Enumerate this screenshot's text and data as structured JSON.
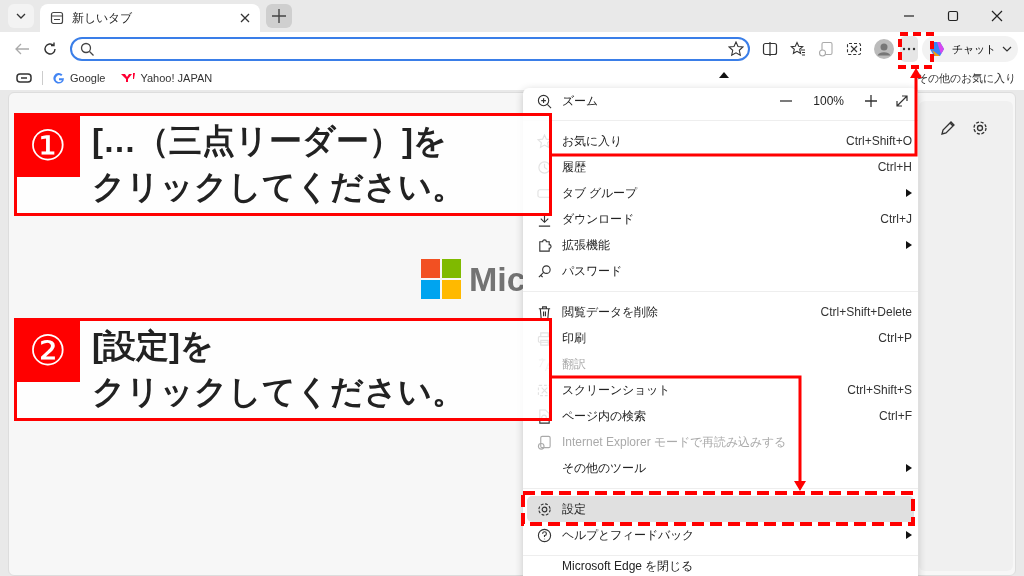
{
  "tabs": [
    {
      "title": "新しいタブ",
      "selected": true
    }
  ],
  "toolbar": {
    "chat_label": "チャット"
  },
  "bookmarks": [
    {
      "label": "Google"
    },
    {
      "label": "Yahoo! JAPAN"
    }
  ],
  "other_favorites": "その他のお気に入り",
  "logo_text": "Mic",
  "menu": {
    "zoom": {
      "label": "ズーム",
      "value": "100%"
    },
    "groups": [
      [
        {
          "label": "お気に入り",
          "shortcut": "Ctrl+Shift+O",
          "submenu": false,
          "disabled": false,
          "selected": false
        },
        {
          "label": "履歴",
          "shortcut": "Ctrl+H",
          "submenu": false,
          "disabled": false,
          "selected": false
        },
        {
          "label": "タブ グループ",
          "submenu": true,
          "disabled": false,
          "selected": false
        },
        {
          "label": "ダウンロード",
          "shortcut": "Ctrl+J",
          "submenu": false,
          "disabled": false,
          "selected": false
        },
        {
          "label": "拡張機能",
          "submenu": true,
          "disabled": false,
          "selected": false
        },
        {
          "label": "パスワード",
          "submenu": false,
          "disabled": false,
          "selected": false
        }
      ],
      [
        {
          "label": "閲覧データを削除",
          "shortcut": "Ctrl+Shift+Delete",
          "submenu": false,
          "disabled": false,
          "selected": false
        },
        {
          "label": "印刷",
          "shortcut": "Ctrl+P",
          "submenu": false,
          "disabled": false,
          "selected": false
        },
        {
          "label": "翻訳",
          "submenu": false,
          "disabled": true,
          "selected": false
        },
        {
          "label": "スクリーンショット",
          "shortcut": "Ctrl+Shift+S",
          "submenu": false,
          "disabled": false,
          "selected": false
        },
        {
          "label": "ページ内の検索",
          "shortcut": "Ctrl+F",
          "submenu": false,
          "disabled": false,
          "selected": false
        },
        {
          "label": "Internet Explorer モードで再読み込みする",
          "submenu": false,
          "disabled": true,
          "selected": false
        },
        {
          "label": "その他のツール",
          "submenu": true,
          "disabled": false,
          "selected": false
        }
      ],
      [
        {
          "label": "設定",
          "submenu": false,
          "disabled": false,
          "selected": true
        },
        {
          "label": "ヘルプとフィードバック",
          "submenu": true,
          "disabled": false,
          "selected": false
        }
      ],
      [
        {
          "label": "Microsoft Edge を閉じる",
          "submenu": false,
          "disabled": false,
          "selected": false
        }
      ]
    ]
  },
  "annotations": [
    {
      "number": "①",
      "lines": [
        "[…（三点リーダー）]を",
        "クリックしてください。"
      ]
    },
    {
      "number": "②",
      "lines": [
        "[設定]を",
        "クリックしてください。"
      ]
    }
  ]
}
